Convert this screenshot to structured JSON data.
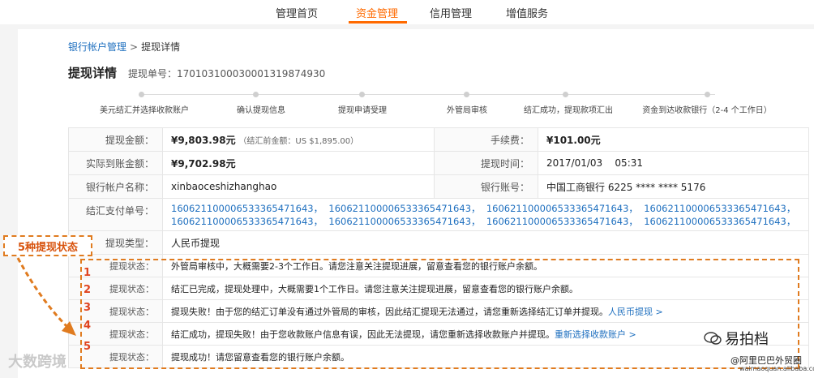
{
  "nav": {
    "tabs": [
      {
        "label": "管理首页"
      },
      {
        "label": "资金管理"
      },
      {
        "label": "信用管理"
      },
      {
        "label": "增值服务"
      }
    ]
  },
  "breadcrumb": {
    "parent": "银行帐户管理",
    "sep": ">",
    "current": "提现详情"
  },
  "header": {
    "title": "提现详情",
    "order_label": "提现单号：",
    "order_no": "170103100030001319874930"
  },
  "steps": [
    "美元结汇并选择收款账户",
    "确认提现信息",
    "提现申请受理",
    "外管局审核",
    "结汇成功，提现款项汇出",
    "资金到达收款银行（2-4 个工作日）"
  ],
  "info": {
    "amount_label": "提现金额：",
    "amount": "¥9,803.98元",
    "amount_note": "（结汇前金额：US $1,895.00）",
    "fee_label": "手续费：",
    "fee": "¥101.00元",
    "actual_label": "实际到账金额：",
    "actual": "¥9,702.98元",
    "time_label": "提现时间：",
    "time": "2017/01/03    05:31",
    "account_name_label": "银行帐户名称：",
    "account_name": "xinbaoceshizhanghao",
    "account_no_label": "银行账号：",
    "account_no": "中国工商银行 6225 **** **** 5176",
    "payment_label": "结汇支付单号：",
    "payment_line1": "160621100006533365471643，  160621100006533365471643，  160621100006533365471643，  160621100006533365471643，",
    "payment_line2": "160621100006533365471643，  160621100006533365471643，  160621100006533365471643，  160621100006533365471643，",
    "type_label": "提现类型：",
    "type": "人民币提现"
  },
  "statuses": [
    {
      "num": "1",
      "label": "提现状态：",
      "text": "外管局审核中，大概需要2-3个工作日。请您注意关注提现进展，留意查看您的银行账户余额。",
      "link": ""
    },
    {
      "num": "2",
      "label": "提现状态：",
      "text": "结汇已完成，提现处理中，大概需要1个工作日。请您注意关注提现进展，留意查看您的银行账户余额。",
      "link": ""
    },
    {
      "num": "3",
      "label": "提现状态：",
      "text": "提现失败！由于您的结汇订单没有通过外管局的审核，因此结汇提现无法通过，请您重新选择结汇订单并提现。",
      "link": "人民币提现 >"
    },
    {
      "num": "4",
      "label": "提现状态：",
      "text": "结汇成功，提现失败！由于您收款账户信息有误，因此无法提现，请您重新选择收款账户并提现。",
      "link": "重新选择收款账户 >"
    },
    {
      "num": "5",
      "label": "提现状态：",
      "text": "提现成功！请您留意查看您的银行账户余额。",
      "link": ""
    }
  ],
  "annotation": {
    "tag": "5种提现状态"
  },
  "watermarks": {
    "left": "大数跨境",
    "right": "易拍档",
    "right_handle": "@阿里巴巴外贸圈",
    "right_url": "waimaoquan.alibaba.com"
  },
  "colors": {
    "accent": "#ff6a00",
    "link": "#1e6fbf",
    "annotation": "#e07b1f",
    "number": "#e0431f"
  }
}
